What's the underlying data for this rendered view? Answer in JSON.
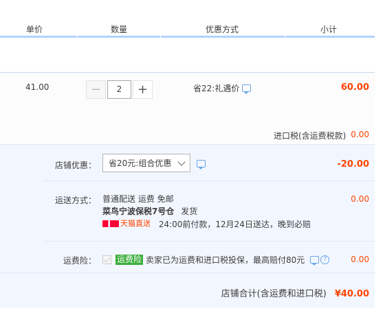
{
  "header": {
    "unit_price": "单价",
    "quantity": "数量",
    "discount_method": "优惠方式",
    "subtotal": "小计"
  },
  "item": {
    "price": "41.00",
    "quantity": "2",
    "minus": "−",
    "plus": "+",
    "promotion": "省22:礼遇价",
    "subtotal": "60.00",
    "tax_label": "进口税(含运费税款)",
    "tax_value": "0.00"
  },
  "shop": {
    "discount_label": "店铺优惠：",
    "discount_selected": "省20元:组合优惠",
    "discount_value": "-20.00",
    "shipping_label": "运送方式：",
    "shipping_line1": "普通配送 运费 免邮",
    "shipping_line2_bold": "菜鸟宁波保税7号仓",
    "shipping_line2_rest": "发货",
    "tmall_badge": "天猫直送",
    "shipping_line3": "24:00前付款，12月24日送达，晚到必赔",
    "shipping_value": "0.00",
    "insurance_label": "运费险：",
    "insurance_badge": "运费险",
    "insurance_text": "卖家已为运费和进口税投保，最高赔付80元",
    "insurance_value": "0.00",
    "total_label": "店铺合计(含运费和进口税)",
    "total_value": "¥40.00"
  },
  "colors": {
    "accent_red": "#ff4400",
    "header_border": "#b2d1ff",
    "shop_bg": "#f2f7ff",
    "badge_green": "#3aae3a"
  }
}
